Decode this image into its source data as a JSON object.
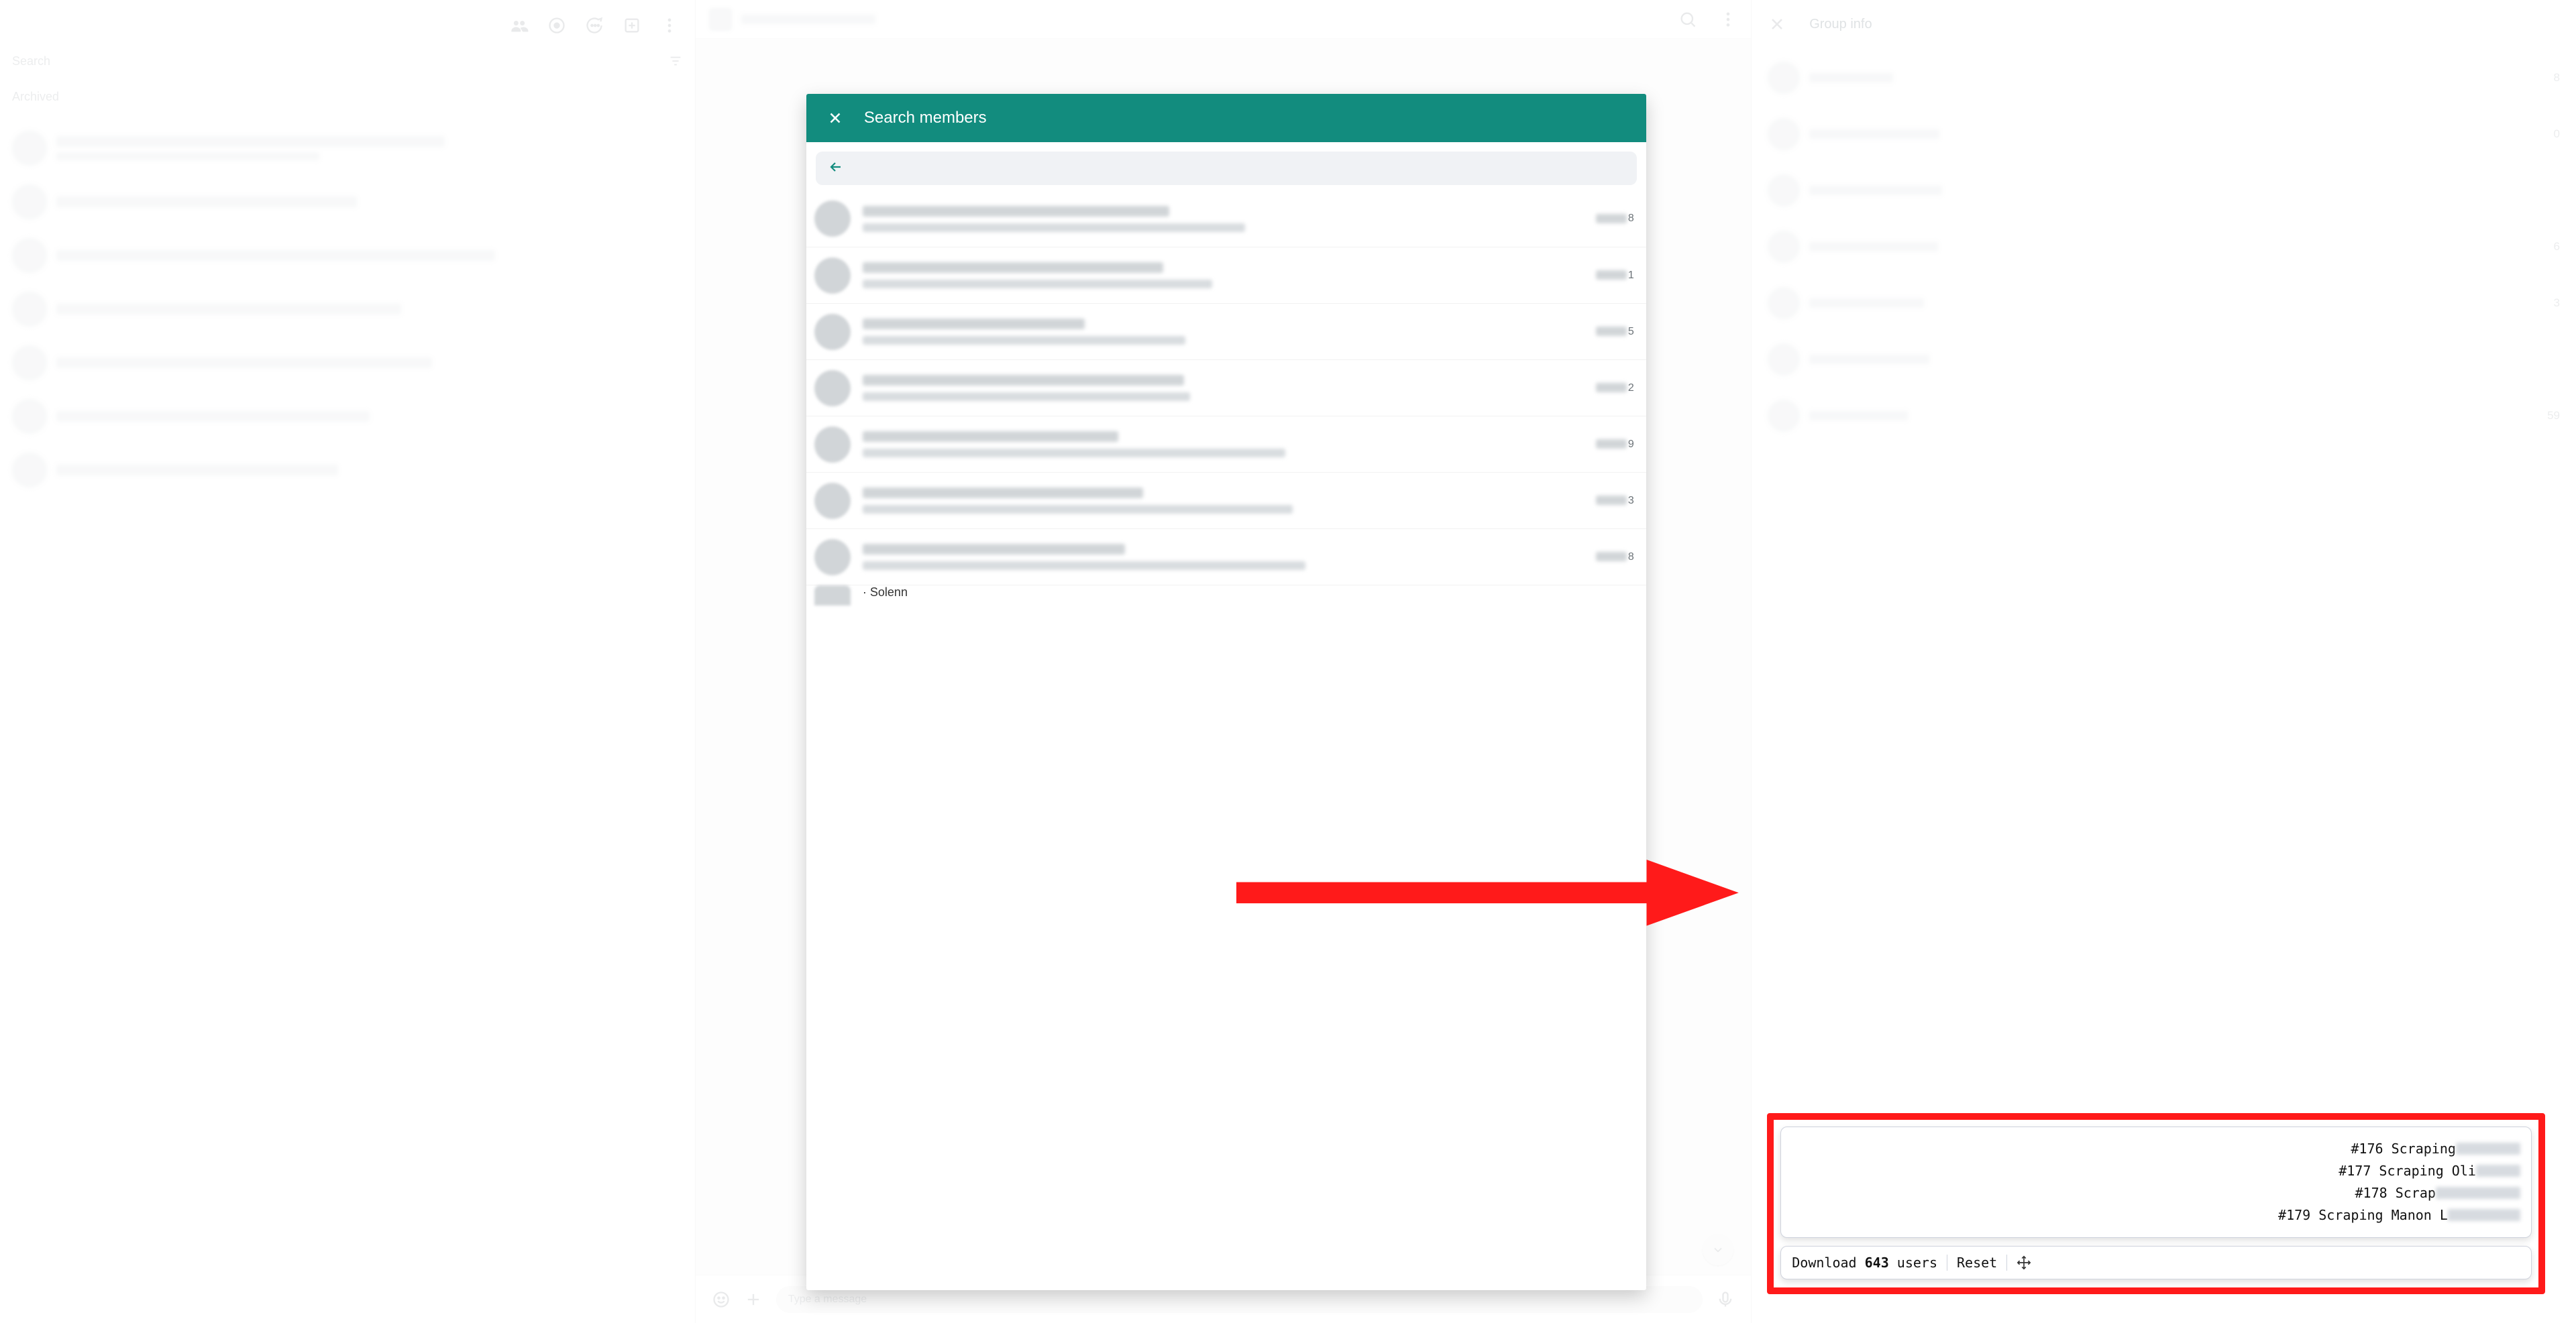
{
  "left": {
    "search_placeholder": "Search",
    "archived_label": "Archived"
  },
  "center": {
    "composer_placeholder": "Type a message"
  },
  "right": {
    "title": "Group info",
    "side_members": [
      {
        "suffix": "8"
      },
      {
        "suffix": "0"
      },
      {
        "suffix": ""
      },
      {
        "suffix": "6"
      },
      {
        "suffix": "3"
      },
      {
        "suffix": ""
      },
      {
        "suffix": "59"
      }
    ]
  },
  "panel": {
    "title": "Search members",
    "input_value": "",
    "members": [
      {
        "suffix": "8"
      },
      {
        "suffix": "1"
      },
      {
        "suffix": "5"
      },
      {
        "suffix": "2"
      },
      {
        "suffix": "9"
      },
      {
        "suffix": "3"
      },
      {
        "suffix": "8"
      }
    ],
    "last_visible_name_fragment": "· Solenn"
  },
  "scraper": {
    "lines": [
      {
        "prefix": "#176 Scraping ",
        "blur_w": 96
      },
      {
        "prefix": "#177 Scraping Oli",
        "blur_w": 66
      },
      {
        "prefix": "#178 Scrap",
        "blur_w": 126
      },
      {
        "prefix": "#179 Scraping Manon L",
        "blur_w": 108
      }
    ],
    "download_prefix": "Download ",
    "download_count": "643",
    "download_suffix": " users",
    "reset_label": "Reset"
  }
}
